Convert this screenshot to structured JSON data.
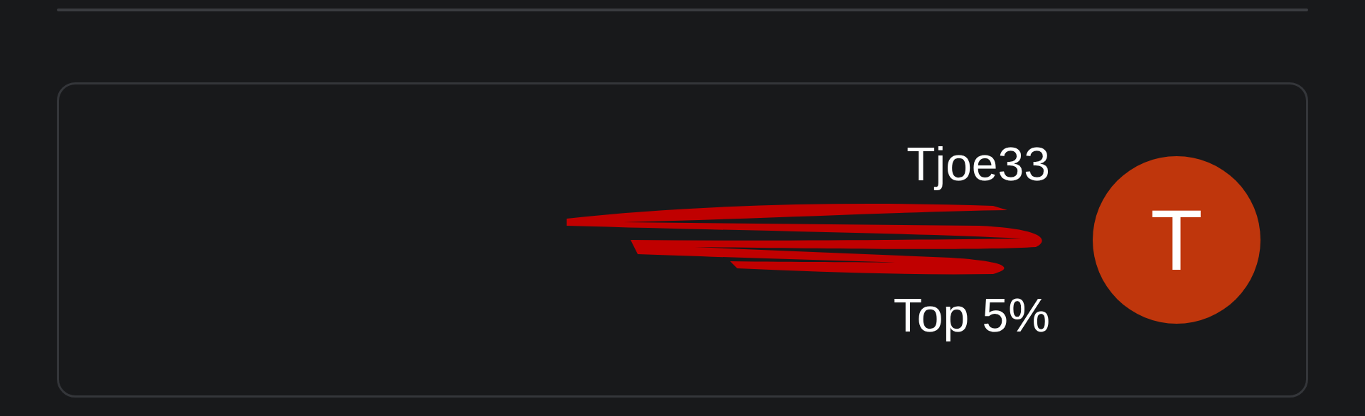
{
  "profile_card": {
    "name": "Tjoe33",
    "rank": "Top 5%",
    "avatar": {
      "initial": "T",
      "color": "#bf360c"
    }
  }
}
